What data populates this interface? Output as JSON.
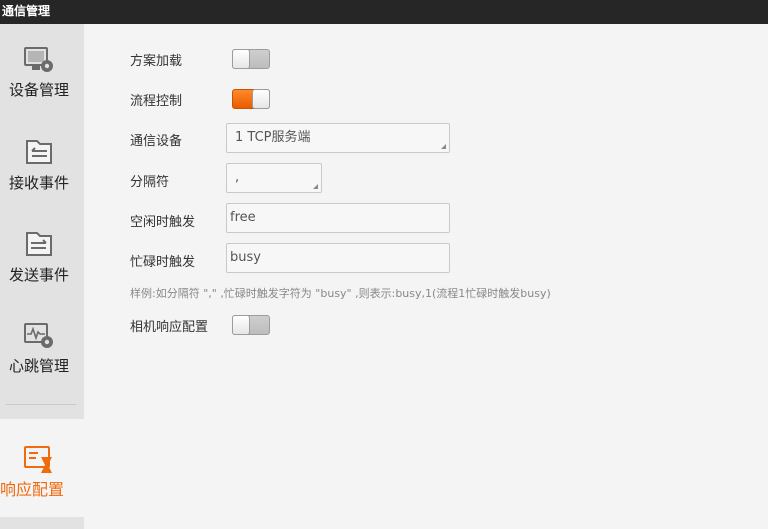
{
  "window": {
    "title": "通信管理"
  },
  "sidebar": {
    "items": [
      {
        "label": "设备管理",
        "icon": "device-settings-icon"
      },
      {
        "label": "接收事件",
        "icon": "receive-folder-icon"
      },
      {
        "label": "发送事件",
        "icon": "send-folder-icon"
      },
      {
        "label": "心跳管理",
        "icon": "heartbeat-settings-icon"
      },
      {
        "label": "响应配置",
        "icon": "response-config-icon",
        "active": true
      }
    ],
    "active_color": "#f06a10"
  },
  "form": {
    "scheme_load": {
      "label": "方案加载",
      "on": false
    },
    "flow_control": {
      "label": "流程控制",
      "on": true
    },
    "comm_device": {
      "label": "通信设备",
      "value": "1 TCP服务端"
    },
    "separator": {
      "label": "分隔符",
      "value": ","
    },
    "idle_trigger": {
      "label": "空闲时触发",
      "value": "free"
    },
    "busy_trigger": {
      "label": "忙碌时触发",
      "value": "busy"
    },
    "hint": "样例:如分隔符 \",\" ,忙碌时触发字符为 \"busy\" ,则表示:busy,1(流程1忙碌时触发busy)",
    "camera_response": {
      "label": "相机响应配置",
      "on": false
    }
  }
}
